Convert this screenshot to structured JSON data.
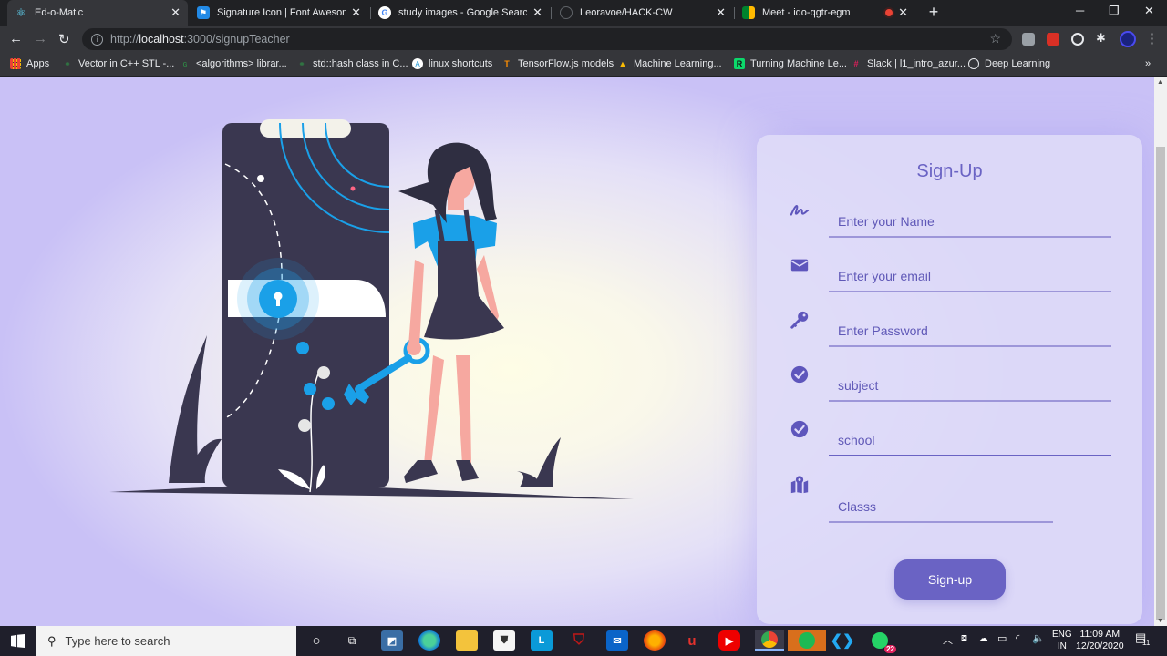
{
  "browser": {
    "tabs": [
      {
        "title": "Ed-o-Matic",
        "icon": "react-icon",
        "active": true
      },
      {
        "title": "Signature Icon | Font Awesome",
        "icon": "font-awesome-flag-icon"
      },
      {
        "title": "study images - Google Search",
        "icon": "google-icon"
      },
      {
        "title": "Leoravoe/HACK-CW",
        "icon": "github-icon"
      },
      {
        "title": "Meet - ido-qgtr-egm",
        "icon": "google-meet-icon"
      }
    ],
    "url_prefix": "http://",
    "url_host": "localhost",
    "url_path": ":3000/signupTeacher",
    "bookmarks": [
      {
        "label": "Apps"
      },
      {
        "label": "Vector in C++ STL -..."
      },
      {
        "label": "<algorithms> librar..."
      },
      {
        "label": "std::hash class in C..."
      },
      {
        "label": "linux shortcuts"
      },
      {
        "label": "TensorFlow.js models"
      },
      {
        "label": "Machine Learning..."
      },
      {
        "label": "Turning Machine Le..."
      },
      {
        "label": "Slack | l1_intro_azur..."
      },
      {
        "label": "Deep Learning"
      }
    ],
    "bookmarks_more": "»"
  },
  "form": {
    "title": "Sign-Up",
    "name_placeholder": "Enter your Name",
    "email_placeholder": "Enter your email",
    "password_placeholder": "Enter Password",
    "subject_placeholder": "subject",
    "school_placeholder": "school",
    "class_placeholder": "Classs",
    "submit_label": "Sign-up",
    "accent_color": "#6a63c4"
  },
  "taskbar": {
    "search_placeholder": "Type here to search",
    "lang_line1": "ENG",
    "lang_line2": "IN",
    "time": "11:09 AM",
    "date": "12/20/2020",
    "notification_count": "11",
    "whatsapp_badge": "22"
  }
}
